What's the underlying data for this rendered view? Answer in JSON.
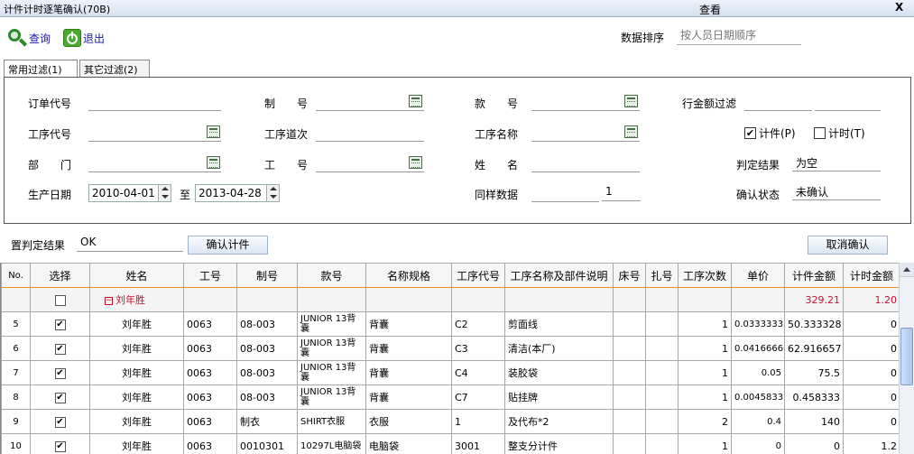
{
  "window": {
    "title": "计件计时逐笔确认(70B)",
    "center_title": "查看",
    "close_label": "X"
  },
  "toolbar": {
    "search_label": "查询",
    "exit_label": "退出",
    "sort_label": "数据排序",
    "sort_placeholder": "按人员日期顺序"
  },
  "tabs": [
    {
      "label": "常用过滤(1)"
    },
    {
      "label": "其它过滤(2)"
    }
  ],
  "filters": {
    "order_code": "订单代号",
    "make_no": "制　　号",
    "style_no": "款　　号",
    "row_amount_filter": "行金额过滤",
    "process_code": "工序代号",
    "process_seq": "工序道次",
    "process_name": "工序名称",
    "dept": "部　　门",
    "worker_no": "工　　号",
    "name": "姓　　名",
    "prod_date": "生产日期",
    "date_from": "2010-04-01",
    "date_to_label": "至",
    "date_to": "2013-04-28",
    "same_data_label": "同样数据",
    "same_data_value": "1",
    "piece_label": "计件(P)",
    "piece_checked": true,
    "time_label": "计时(T)",
    "time_checked": false,
    "judge_label": "判定结果",
    "judge_value": "为空",
    "confirm_state_label": "确认状态",
    "confirm_state_value": "未确认"
  },
  "actions": {
    "set_judge_label": "置判定结果",
    "set_judge_value": "OK",
    "confirm_btn": "确认计件",
    "cancel_btn": "取消确认"
  },
  "table": {
    "headers": [
      "No.",
      "选择",
      "姓名",
      "工号",
      "制号",
      "款号",
      "名称规格",
      "工序代号",
      "工序名称及部件说明",
      "床号",
      "扎号",
      "工序次数",
      "单价",
      "计件金额",
      "计时金额"
    ],
    "group": {
      "name": "刘年胜",
      "expander": "−",
      "piece_amount": "329.21",
      "time_amount": "1.20"
    },
    "rows": [
      {
        "no": "5",
        "name": "刘年胜",
        "worker": "0063",
        "make": "08-003",
        "style": "JUNIOR 13背囊",
        "spec": "背囊",
        "proc_code": "C2",
        "proc_name": "剪面线",
        "bed": "",
        "bundle": "",
        "times": "1",
        "price": "0.03333333",
        "piece": "50.333328",
        "time": "0"
      },
      {
        "no": "6",
        "name": "刘年胜",
        "worker": "0063",
        "make": "08-003",
        "style": "JUNIOR 13背囊",
        "spec": "背囊",
        "proc_code": "C3",
        "proc_name": "清洁(本厂)",
        "bed": "",
        "bundle": "",
        "times": "1",
        "price": "0.04166666",
        "piece": "62.916657",
        "time": "0"
      },
      {
        "no": "7",
        "name": "刘年胜",
        "worker": "0063",
        "make": "08-003",
        "style": "JUNIOR 13背囊",
        "spec": "背囊",
        "proc_code": "C4",
        "proc_name": "装胶袋",
        "bed": "",
        "bundle": "",
        "times": "1",
        "price": "0.05",
        "piece": "75.5",
        "time": "0"
      },
      {
        "no": "8",
        "name": "刘年胜",
        "worker": "0063",
        "make": "08-003",
        "style": "JUNIOR 13背囊",
        "spec": "背囊",
        "proc_code": "C7",
        "proc_name": "贴挂牌",
        "bed": "",
        "bundle": "",
        "times": "1",
        "price": "0.00458333",
        "piece": "0.458333",
        "time": "0"
      },
      {
        "no": "9",
        "name": "刘年胜",
        "worker": "0063",
        "make": "制衣",
        "style": "SHIRT衣服",
        "spec": "衣服",
        "proc_code": "1",
        "proc_name": "及代布*2",
        "bed": "",
        "bundle": "",
        "times": "2",
        "price": "0.4",
        "piece": "140",
        "time": "0"
      },
      {
        "no": "10",
        "name": "刘年胜",
        "worker": "0063",
        "make": "0010301",
        "style": "10297L电脑袋",
        "spec": "电脑袋",
        "proc_code": "3001",
        "proc_name": "整支分计件",
        "bed": "",
        "bundle": "",
        "times": "1",
        "price": "0",
        "piece": "0",
        "time": "1.2"
      }
    ]
  }
}
